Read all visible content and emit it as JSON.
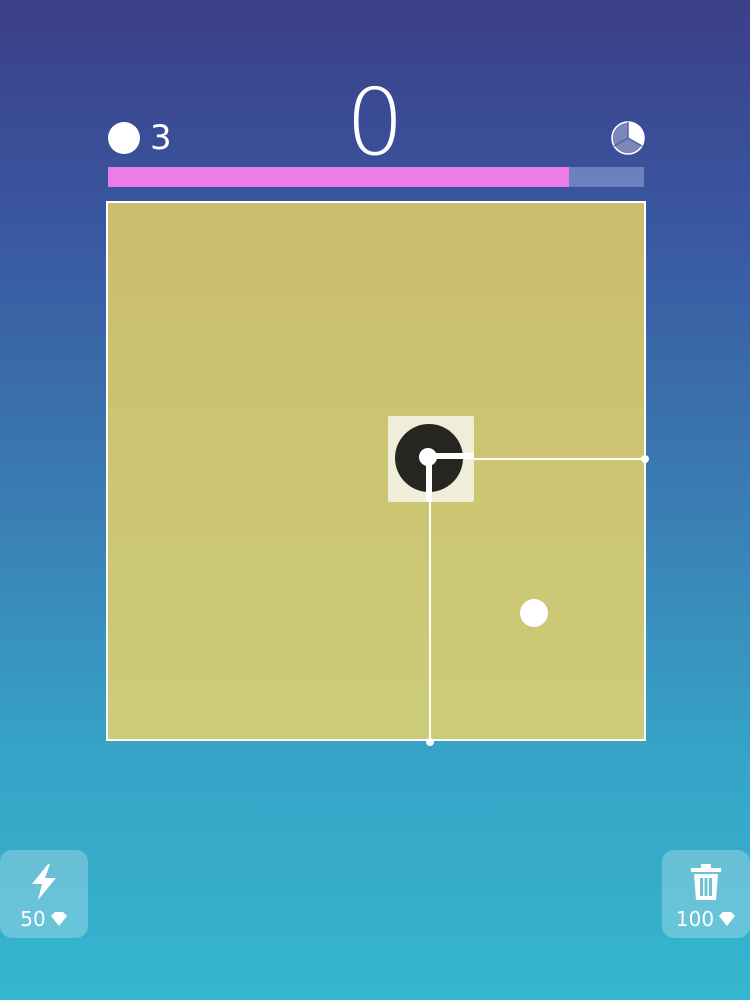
{
  "hud": {
    "lives": "3",
    "score": "0",
    "progress": 0.86
  },
  "board": {
    "fill_color": "#cbc474"
  },
  "powerups": {
    "lightning_cost": "50",
    "trash_cost": "100"
  },
  "icons": {
    "lives": "ball-icon",
    "timer": "pie-timer-icon",
    "lightning": "lightning-icon",
    "trash": "trash-icon",
    "gem": "gem-icon"
  },
  "colors": {
    "progress_fill": "#ee7ce8",
    "background_top": "#3b3f88",
    "background_bottom": "#35b6cf"
  }
}
